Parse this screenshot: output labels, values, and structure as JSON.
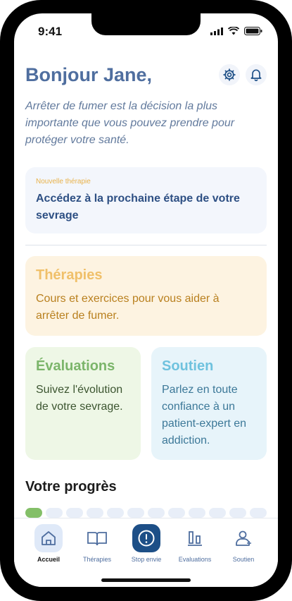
{
  "status": {
    "time": "9:41"
  },
  "header": {
    "greeting": "Bonjour Jane,"
  },
  "intro": {
    "text": "Arrêter de fumer est la décision la plus importante que vous pouvez prendre pour protéger votre santé."
  },
  "next_step": {
    "kicker": "Nouvelle thérapie",
    "title": "Accédez à la prochaine étape de votre sevrage"
  },
  "cards": {
    "therapies": {
      "title": "Thérapies",
      "text": "Cours et exercices pour vous aider à arrêter de fumer."
    },
    "evaluations": {
      "title": "Évaluations",
      "text": "Suivez l'évolution de votre sevrage."
    },
    "soutien": {
      "title": "Soutien",
      "text": "Parlez en toute confiance à un patient-expert en addiction."
    }
  },
  "progress": {
    "title": "Votre progrès",
    "completed": 1,
    "total": 12
  },
  "tabs": {
    "accueil": "Accueil",
    "therapies": "Thérapies",
    "stop": "Stop envie",
    "evaluations": "Evaluations",
    "soutien": "Soutien"
  },
  "colors": {
    "primary": "#4f6e9f",
    "therapies_bg": "#fdf3e1",
    "therapies_title": "#f0c06a",
    "therapies_text": "#b9801f",
    "evaluations_bg": "#eef7e6",
    "evaluations_title": "#7bb56a",
    "evaluations_text": "#3c5530",
    "soutien_bg": "#e7f4fa",
    "soutien_title": "#6fc2de",
    "soutien_text": "#3c7898"
  },
  "icons": [
    "gear-icon",
    "bell-icon",
    "home-icon",
    "book-icon",
    "alert-icon",
    "chart-icon",
    "user-icon"
  ]
}
